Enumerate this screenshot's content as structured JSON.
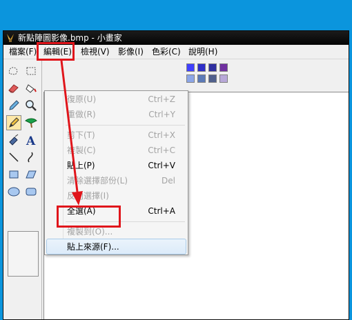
{
  "window": {
    "title": "新點陣圖影像.bmp - 小畫家"
  },
  "menubar": {
    "file": "檔案(F)",
    "edit": "編輯(E)",
    "view": "檢視(V)",
    "image": "影像(I)",
    "colors": "色彩(C)",
    "help": "說明(H)"
  },
  "edit_menu": {
    "undo": {
      "label": "復原(U)",
      "shortcut": "Ctrl+Z",
      "enabled": false
    },
    "redo": {
      "label": "重做(R)",
      "shortcut": "Ctrl+Y",
      "enabled": false
    },
    "cut": {
      "label": "剪下(T)",
      "shortcut": "Ctrl+X",
      "enabled": false
    },
    "copy": {
      "label": "複製(C)",
      "shortcut": "Ctrl+C",
      "enabled": false
    },
    "paste": {
      "label": "貼上(P)",
      "shortcut": "Ctrl+V",
      "enabled": true
    },
    "clear_selection": {
      "label": "清除選擇部份(L)",
      "shortcut": "Del",
      "enabled": false
    },
    "invert_selection": {
      "label": "反向選擇(I)",
      "enabled": false
    },
    "select_all": {
      "label": "全選(A)",
      "shortcut": "Ctrl+A",
      "enabled": true
    },
    "copy_to": {
      "label": "複製到(O)...",
      "enabled": false
    },
    "paste_from": {
      "label": "貼上來源(F)...",
      "enabled": true,
      "highlighted": true
    }
  },
  "tools": [
    "free-form-select",
    "select",
    "eraser",
    "fill-with-color",
    "pick-color",
    "magnifier",
    "pencil",
    "brush",
    "airbrush",
    "text",
    "line",
    "curve",
    "rectangle",
    "polygon",
    "ellipse",
    "rounded-rectangle"
  ],
  "selected_tool": "pencil",
  "palette": {
    "row1": [
      "#4040ff",
      "#2f2fc8",
      "#3030a0",
      "#7030a0"
    ],
    "row2": [
      "#8ca6e8",
      "#5b7ab8",
      "#50608c",
      "#b8a8d8"
    ]
  },
  "annotation": {
    "color": "#e0151b"
  }
}
